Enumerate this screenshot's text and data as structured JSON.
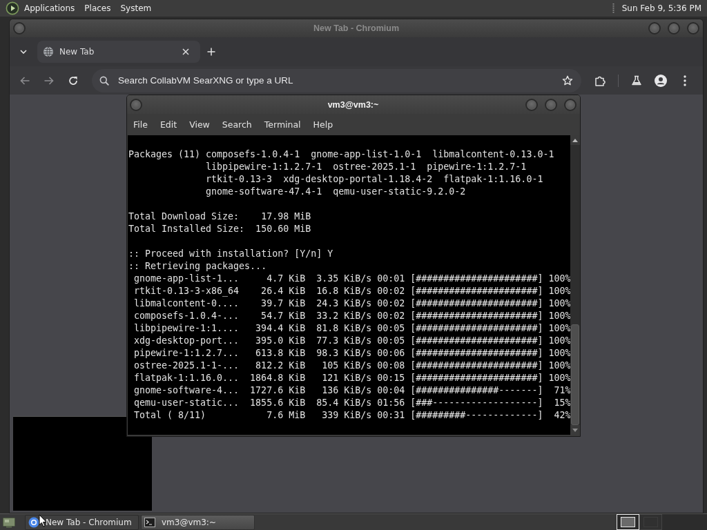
{
  "top_panel": {
    "menus": [
      "Applications",
      "Places",
      "System"
    ],
    "clock": "Sun Feb 9, 5:36 PM"
  },
  "browser_window": {
    "title": "New Tab - Chromium",
    "active": false,
    "tabs": [
      {
        "label": "New Tab",
        "selected": true
      }
    ],
    "nav_buttons": [
      {
        "kind": "back",
        "disabled": true
      },
      {
        "kind": "forward",
        "disabled": true
      },
      {
        "kind": "reload",
        "disabled": false
      }
    ],
    "address_bar": {
      "placeholder": "Search CollabVM SearXNG or type a URL"
    }
  },
  "terminal_window": {
    "title": "vm3@vm3:~",
    "active": true,
    "menus": [
      "File",
      "Edit",
      "View",
      "Search",
      "Terminal",
      "Help"
    ],
    "output": [
      {
        "kind": "packages",
        "label": "Packages (11)",
        "lines": [
          "composefs-1.0.4-1  gnome-app-list-1.0-1  libmalcontent-0.13.0-1",
          "libpipewire-1:1.2.7-1  ostree-2025.1-1  pipewire-1:1.2.7-1",
          "rtkit-0.13-3  xdg-desktop-portal-1.18.4-2  flatpak-1:1.16.0-1",
          "gnome-software-47.4-1  qemu-user-static-9.2.0-2"
        ]
      },
      {
        "kind": "text",
        "lines": [
          "Total Download Size:    17.98 MiB",
          "Total Installed Size:  150.60 MiB"
        ]
      },
      {
        "kind": "text",
        "lines": [
          ":: Proceed with installation? [Y/n] Y",
          ":: Retrieving packages..."
        ]
      },
      {
        "kind": "progress",
        "lines": [
          "gnome-app-list-1...     4.7 KiB  3.35 KiB/s 00:01 [######################] 100%",
          "rtkit-0.13-3-x86_64    26.4 KiB  16.8 KiB/s 00:02 [######################] 100%",
          "libmalcontent-0....    39.7 KiB  24.3 KiB/s 00:02 [######################] 100%",
          "composefs-1.0.4-...    54.7 KiB  33.2 KiB/s 00:02 [######################] 100%",
          "libpipewire-1:1....   394.4 KiB  81.8 KiB/s 00:05 [######################] 100%",
          "xdg-desktop-port...   395.0 KiB  77.3 KiB/s 00:05 [######################] 100%",
          "pipewire-1:1.2.7...   613.8 KiB  98.3 KiB/s 00:06 [######################] 100%",
          "ostree-2025.1-1-...   812.2 KiB   105 KiB/s 00:08 [######################] 100%",
          "flatpak-1:1.16.0...  1864.8 KiB   121 KiB/s 00:15 [######################] 100%",
          "gnome-software-4...  1727.6 KiB   136 KiB/s 00:04 [###############-------]  71%",
          "qemu-user-static...  1855.6 KiB  85.4 KiB/s 01:56 [###-------------------]  15%",
          "Total ( 8/11)           7.6 MiB   339 KiB/s 00:31 [#########-------------]  42%"
        ]
      }
    ]
  },
  "taskbar": {
    "windows": [
      {
        "label": "New Tab - Chromium",
        "kind": "browser",
        "selected": false
      },
      {
        "label": "vm3@vm3:~",
        "kind": "terminal",
        "selected": true
      }
    ],
    "workspaces": [
      {
        "selected": true
      },
      {
        "selected": false
      }
    ]
  }
}
